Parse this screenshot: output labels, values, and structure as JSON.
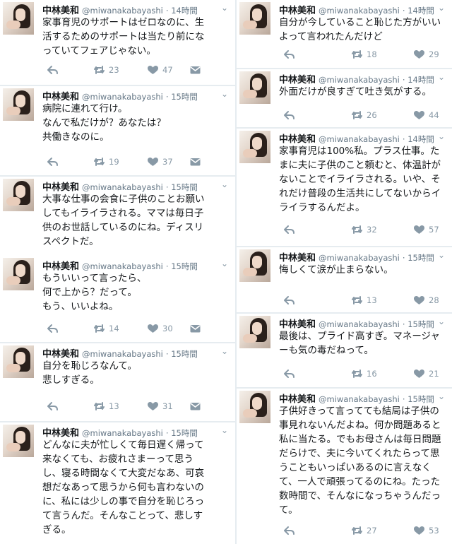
{
  "columns": [
    {
      "tweets": [
        {
          "name": "中林美和",
          "handle": "@miwanakabayashi",
          "time": "· 14時間",
          "lines": [
            "家事育児のサポートはゼロなのに、生",
            "活するためのサポートは当たり前にな",
            "っていてフェアじゃない。"
          ],
          "retweets": "23",
          "likes": "47"
        },
        {
          "name": "中林美和",
          "handle": "@miwanakabayashi",
          "time": "· 15時間",
          "lines": [
            "病院に連れて行け。",
            "なんで私だけが？あなたは？",
            "共働きなのに。"
          ],
          "retweets": "19",
          "likes": "37"
        },
        {
          "name": "中林美和",
          "handle": "@miwanakabayashi",
          "time": "· 15時間",
          "lines": [
            "大事な仕事の会食に子供のことお願い",
            "してもイライラされる。ママは毎日子",
            "供のお世話しているのにね。ディスリ",
            "スペクトだ。"
          ],
          "retweets": "",
          "likes": ""
        },
        {
          "name": "中林美和",
          "handle": "@miwanakabayashi",
          "time": "· 15時間",
          "lines": [
            "もういいって言ったら、",
            "何で上から？だって。",
            "もう、いいよね。"
          ],
          "retweets": "14",
          "likes": "30"
        },
        {
          "name": "中林美和",
          "handle": "@miwanakabayashi",
          "time": "· 15時間",
          "lines": [
            "自分を恥じろなんて。",
            "悲しすぎる。"
          ],
          "retweets": "13",
          "likes": "31"
        },
        {
          "name": "中林美和",
          "handle": "@miwanakabayashi",
          "time": "· 15時間",
          "lines": [
            "どんなに夫が忙しくて毎日遅く帰って",
            "来なくても、お疲れさまーって思う",
            "し、寝る時間なくて大変だなあ、可哀",
            "想だなあって思うから何も言わないの",
            "に、私には少しの事で自分を恥じろっ",
            "て言うんだ。そんなことって、悲しす",
            "ぎる。"
          ],
          "retweets": "",
          "likes": ""
        }
      ]
    },
    {
      "tweets": [
        {
          "name": "中林美和",
          "handle": "@miwanakabayashi",
          "time": "· 14時間",
          "lines": [
            "自分が今していること恥じた方がいい",
            "よって言われたんだけど"
          ],
          "retweets": "18",
          "likes": "29"
        },
        {
          "name": "中林美和",
          "handle": "@miwanakabayashi",
          "time": "· 14時間",
          "lines": [
            "外面だけが良すぎて吐き気がする。"
          ],
          "retweets": "26",
          "likes": "44"
        },
        {
          "name": "中林美和",
          "handle": "@miwanakabayashi",
          "time": "· 14時間",
          "lines": [
            "家事育児は100%私。プラス仕事。た",
            "まに夫に子供のこと頼むと、体温計が",
            "ないことでイライラされる。いや、そ",
            "れだけ普段の生活共にしてないからイ",
            "ライラするんだよ。"
          ],
          "retweets": "32",
          "likes": "57"
        },
        {
          "name": "中林美和",
          "handle": "@miwanakabayashi",
          "time": "· 15時間",
          "lines": [
            "悔しくて涙が止まらない。"
          ],
          "retweets": "13",
          "likes": "28"
        },
        {
          "name": "中林美和",
          "handle": "@miwanakabayashi",
          "time": "· 15時間",
          "lines": [
            "最後は、プライド高すぎ。マネージャ",
            "ーも気の毒だねって。"
          ],
          "retweets": "16",
          "likes": "21"
        },
        {
          "name": "中林美和",
          "handle": "@miwanakabayashi",
          "time": "· 15時間",
          "lines": [
            "子供好きって言ってても結局は子供の",
            "事見れないんだよね。何か問題あると",
            "私に当たる。でもお母さんは毎日問題",
            "だらけで、夫に今いてくれたらって思",
            "うこともいっぱいあるのに言えなく",
            "て、一人で頑張ってるのにね。たった",
            "数時間で、そんなになっちゃうんだっ",
            "て。"
          ],
          "retweets": "27",
          "likes": "53"
        }
      ]
    }
  ],
  "icons": {
    "reply": "reply-icon",
    "retweet": "retweet-icon",
    "like": "heart-icon",
    "message": "dm-icon",
    "menu": "chevron-down-icon"
  },
  "colors": {
    "action_gray": "#8899a6",
    "handle_gray": "#657786",
    "divider": "#e6ecf0"
  }
}
